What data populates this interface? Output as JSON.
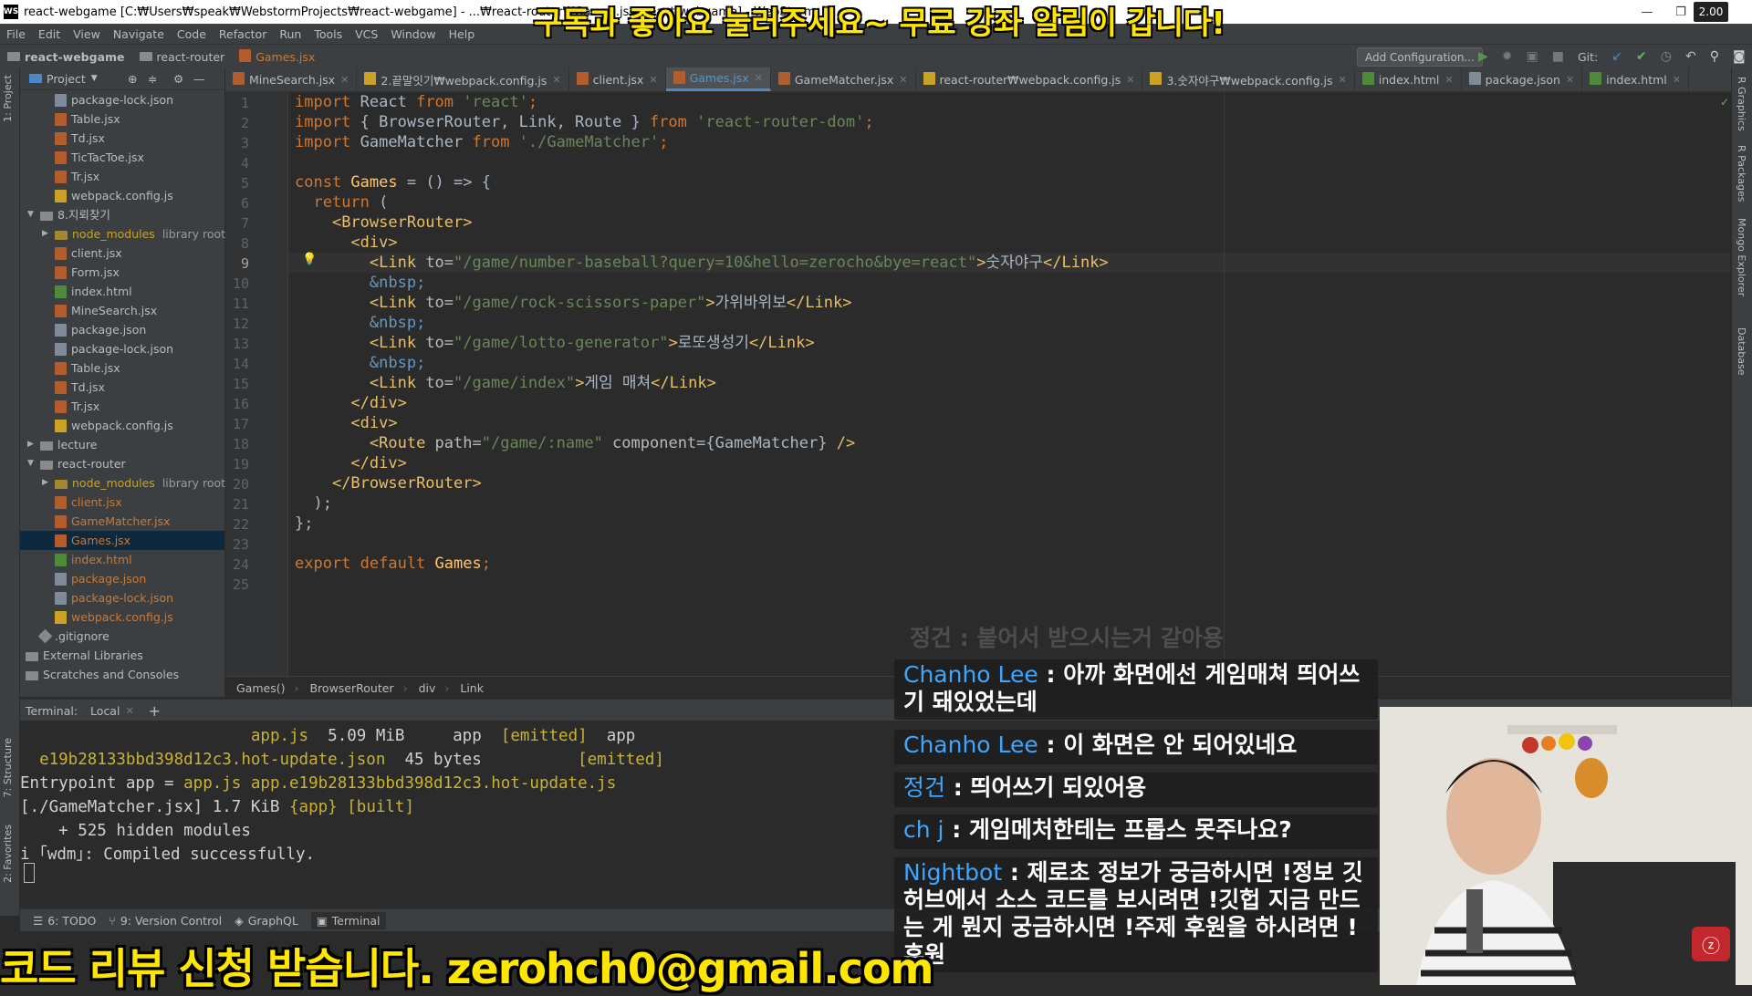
{
  "window": {
    "title": "react-webgame [C:₩Users₩speak₩WebstormProjects₩react-webgame] - ...₩react-router₩Games.jsx [react-webgame] - WebStorm",
    "zoom_badge": "2.00"
  },
  "menu": [
    "File",
    "Edit",
    "View",
    "Navigate",
    "Code",
    "Refactor",
    "Run",
    "Tools",
    "VCS",
    "Window",
    "Help"
  ],
  "navbar": {
    "crumbs": [
      "react-webgame",
      "react-router",
      "Games.jsx"
    ],
    "add_configuration": "Add Configuration...",
    "git_label": "Git:"
  },
  "side_strips": {
    "left": [
      "1: Project",
      "7: Structure",
      "2: Favorites"
    ],
    "right": [
      "R Graphics",
      "R Packages",
      "Mongo Explorer",
      "Database"
    ]
  },
  "project_panel": {
    "title": "Project",
    "items": [
      {
        "label": "package-lock.json",
        "type": "json",
        "indent": 2
      },
      {
        "label": "Table.jsx",
        "type": "jsx",
        "indent": 2
      },
      {
        "label": "Td.jsx",
        "type": "jsx",
        "indent": 2
      },
      {
        "label": "TicTacToe.jsx",
        "type": "jsx",
        "indent": 2
      },
      {
        "label": "Tr.jsx",
        "type": "jsx",
        "indent": 2
      },
      {
        "label": "webpack.config.js",
        "type": "js",
        "indent": 2
      },
      {
        "label": "8.지뢰찾기",
        "type": "dir",
        "indent": 1,
        "arrow": "▼"
      },
      {
        "label": "node_modules",
        "type": "dir",
        "indent": 2,
        "arrow": "▶",
        "suffix": "library root",
        "lib": true
      },
      {
        "label": "client.jsx",
        "type": "jsx",
        "indent": 2
      },
      {
        "label": "Form.jsx",
        "type": "jsx",
        "indent": 2
      },
      {
        "label": "index.html",
        "type": "html",
        "indent": 2
      },
      {
        "label": "MineSearch.jsx",
        "type": "jsx",
        "indent": 2
      },
      {
        "label": "package.json",
        "type": "json",
        "indent": 2
      },
      {
        "label": "package-lock.json",
        "type": "json",
        "indent": 2
      },
      {
        "label": "Table.jsx",
        "type": "jsx",
        "indent": 2
      },
      {
        "label": "Td.jsx",
        "type": "jsx",
        "indent": 2
      },
      {
        "label": "Tr.jsx",
        "type": "jsx",
        "indent": 2
      },
      {
        "label": "webpack.config.js",
        "type": "js",
        "indent": 2
      },
      {
        "label": "lecture",
        "type": "dir",
        "indent": 1,
        "arrow": "▶"
      },
      {
        "label": "react-router",
        "type": "dir",
        "indent": 1,
        "arrow": "▼"
      },
      {
        "label": "node_modules",
        "type": "dir",
        "indent": 2,
        "arrow": "▶",
        "suffix": "library root",
        "lib": true
      },
      {
        "label": "client.jsx",
        "type": "jsx",
        "indent": 2,
        "vcs": true
      },
      {
        "label": "GameMatcher.jsx",
        "type": "jsx",
        "indent": 2,
        "vcs": true
      },
      {
        "label": "Games.jsx",
        "type": "jsx",
        "indent": 2,
        "vcs": true,
        "selected": true
      },
      {
        "label": "index.html",
        "type": "html",
        "indent": 2,
        "vcs": true
      },
      {
        "label": "package.json",
        "type": "json",
        "indent": 2,
        "vcs": true
      },
      {
        "label": "package-lock.json",
        "type": "json",
        "indent": 2,
        "vcs": true
      },
      {
        "label": "webpack.config.js",
        "type": "js",
        "indent": 2,
        "vcs": true
      },
      {
        "label": ".gitignore",
        "type": "git",
        "indent": 1
      },
      {
        "label": "External Libraries",
        "type": "dir",
        "indent": 0
      },
      {
        "label": "Scratches and Consoles",
        "type": "dir",
        "indent": 0
      }
    ]
  },
  "tabs": [
    {
      "label": "MineSearch.jsx",
      "type": "jsx"
    },
    {
      "label": "2.끝말잇기₩webpack.config.js",
      "type": "js"
    },
    {
      "label": "client.jsx",
      "type": "jsx"
    },
    {
      "label": "Games.jsx",
      "type": "jsx",
      "active": true
    },
    {
      "label": "GameMatcher.jsx",
      "type": "jsx"
    },
    {
      "label": "react-router₩webpack.config.js",
      "type": "js"
    },
    {
      "label": "3.숫자야구₩webpack.config.js",
      "type": "js"
    },
    {
      "label": "index.html",
      "type": "html"
    },
    {
      "label": "package.json",
      "type": "json"
    },
    {
      "label": "index.html",
      "type": "html"
    }
  ],
  "code_lines": [
    [
      [
        "kw",
        "import "
      ],
      [
        "plain",
        "React "
      ],
      [
        "kw",
        "from "
      ],
      [
        "str",
        "'react'"
      ],
      [
        "kw",
        ";"
      ]
    ],
    [
      [
        "kw",
        "import "
      ],
      [
        "plain",
        "{ BrowserRouter, Link, Route } "
      ],
      [
        "kw",
        "from "
      ],
      [
        "str",
        "'react-router-dom'"
      ],
      [
        "kw",
        ";"
      ]
    ],
    [
      [
        "kw",
        "import "
      ],
      [
        "plain",
        "GameMatcher "
      ],
      [
        "kw",
        "from "
      ],
      [
        "str",
        "'./GameMatcher'"
      ],
      [
        "kw",
        ";"
      ]
    ],
    [],
    [
      [
        "kw",
        "const "
      ],
      [
        "fn",
        "Games "
      ],
      [
        "plain",
        "= () => {"
      ]
    ],
    [
      [
        "plain",
        "  "
      ],
      [
        "kw",
        "return "
      ],
      [
        "plain",
        "("
      ]
    ],
    [
      [
        "plain",
        "    "
      ],
      [
        "tag",
        "<BrowserRouter>"
      ]
    ],
    [
      [
        "plain",
        "      "
      ],
      [
        "tag",
        "<div>"
      ]
    ],
    [
      [
        "plain",
        "        "
      ],
      [
        "tag",
        "<Link "
      ],
      [
        "attr",
        "to"
      ],
      [
        "plain",
        "="
      ],
      [
        "str",
        "\"/game/number-baseball?query=10&hello=zerocho&bye=react\""
      ],
      [
        "tag",
        ">"
      ],
      [
        "plain",
        "숫자야구"
      ],
      [
        "tag",
        "</Link>"
      ]
    ],
    [
      [
        "plain",
        "        "
      ],
      [
        "ent",
        "&nbsp;"
      ]
    ],
    [
      [
        "plain",
        "        "
      ],
      [
        "tag",
        "<Link "
      ],
      [
        "attr",
        "to"
      ],
      [
        "plain",
        "="
      ],
      [
        "str",
        "\"/game/rock-scissors-paper\""
      ],
      [
        "tag",
        ">"
      ],
      [
        "plain",
        "가위바위보"
      ],
      [
        "tag",
        "</Link>"
      ]
    ],
    [
      [
        "plain",
        "        "
      ],
      [
        "ent",
        "&nbsp;"
      ]
    ],
    [
      [
        "plain",
        "        "
      ],
      [
        "tag",
        "<Link "
      ],
      [
        "attr",
        "to"
      ],
      [
        "plain",
        "="
      ],
      [
        "str",
        "\"/game/lotto-generator\""
      ],
      [
        "tag",
        ">"
      ],
      [
        "plain",
        "로또생성기"
      ],
      [
        "tag",
        "</Link>"
      ]
    ],
    [
      [
        "plain",
        "        "
      ],
      [
        "ent",
        "&nbsp;"
      ]
    ],
    [
      [
        "plain",
        "        "
      ],
      [
        "tag",
        "<Link "
      ],
      [
        "attr",
        "to"
      ],
      [
        "plain",
        "="
      ],
      [
        "str",
        "\"/game/index\""
      ],
      [
        "tag",
        ">"
      ],
      [
        "plain",
        "게임 매쳐"
      ],
      [
        "tag",
        "</Link>"
      ]
    ],
    [
      [
        "plain",
        "      "
      ],
      [
        "tag",
        "</div>"
      ]
    ],
    [
      [
        "plain",
        "      "
      ],
      [
        "tag",
        "<div>"
      ]
    ],
    [
      [
        "plain",
        "        "
      ],
      [
        "tag",
        "<Route "
      ],
      [
        "attr",
        "path"
      ],
      [
        "plain",
        "="
      ],
      [
        "str",
        "\"/game/:name\" "
      ],
      [
        "attr",
        "component"
      ],
      [
        "plain",
        "={GameMatcher} "
      ],
      [
        "tag",
        "/>"
      ]
    ],
    [
      [
        "plain",
        "      "
      ],
      [
        "tag",
        "</div>"
      ]
    ],
    [
      [
        "plain",
        "    "
      ],
      [
        "tag",
        "</BrowserRouter>"
      ]
    ],
    [
      [
        "plain",
        "  );"
      ]
    ],
    [
      [
        "plain",
        "};"
      ]
    ],
    [],
    [
      [
        "kw",
        "export default "
      ],
      [
        "fn",
        "Games"
      ],
      [
        "kw",
        ";"
      ]
    ],
    []
  ],
  "editor_breadcrumb": [
    "Games()",
    "BrowserRouter",
    "div",
    "Link"
  ],
  "terminal": {
    "label": "Terminal:",
    "tab": "Local",
    "lines": [
      [
        [
          "tw",
          "                        "
        ],
        [
          "ty",
          "app.js"
        ],
        [
          "tw",
          "  5.09 MiB     "
        ],
        [
          "tw",
          "app"
        ],
        [
          "ty",
          "  [emitted]  "
        ],
        [
          "tw",
          "app"
        ]
      ],
      [
        [
          "ty",
          "  e19b28133bbd398d12c3.hot-update.json"
        ],
        [
          "tw",
          "  45 bytes          "
        ],
        [
          "ty",
          "[emitted]"
        ]
      ],
      [
        [
          "tw",
          "Entrypoint app = "
        ],
        [
          "ty",
          "app.js app.e19b28133bbd398d12c3.hot-update.js"
        ]
      ],
      [
        [
          "tw",
          "[./GameMatcher.jsx] 1.7 KiB "
        ],
        [
          "ty",
          "{app}"
        ],
        [
          "tw",
          " "
        ],
        [
          "ty",
          "[built]"
        ]
      ],
      [
        [
          "tw",
          "    + 525 hidden modules"
        ]
      ],
      [
        [
          "tw",
          "i "
        ],
        [
          "tw",
          "｢wdm｣"
        ],
        [
          "tw",
          ": Compiled successfully."
        ]
      ]
    ]
  },
  "bottom_tools": [
    "6: TODO",
    "9: Version Control",
    "GraphQL",
    "Terminal"
  ],
  "overlays": {
    "top": "구독과 좋아요 눌러주세요~ 무료 강좌 알림이 갑니다!",
    "bottom": "코드 리뷰 신청 받습니다. zerohch0@gmail.com"
  },
  "chat": {
    "faded": "정건 : 붙어서 받으시는거 같아용",
    "messages": [
      {
        "name": "Chanho Lee",
        "text": "아까 화면에선 게임매쳐 띄어쓰기 돼있었는데"
      },
      {
        "name": "Chanho Lee",
        "text": "이 화면은 안 되어있네요"
      },
      {
        "name": "정건",
        "text": "띄어쓰기 되있어용"
      },
      {
        "name": "ch j",
        "text": "게임메처한테는 프롭스 못주나요?"
      },
      {
        "name": "Nightbot",
        "text": "제로초 정보가 궁금하시면 !정보 깃허브에서 소스 코드를 보시려면 !깃헙 지금 만드는 게 뭔지 궁금하시면 !주제 후원을 하시려면 !후원"
      }
    ]
  },
  "colors": {
    "accent": "#4a88c7",
    "overlay_text": "#ffe600",
    "chat_name": "#3ea6ff"
  }
}
